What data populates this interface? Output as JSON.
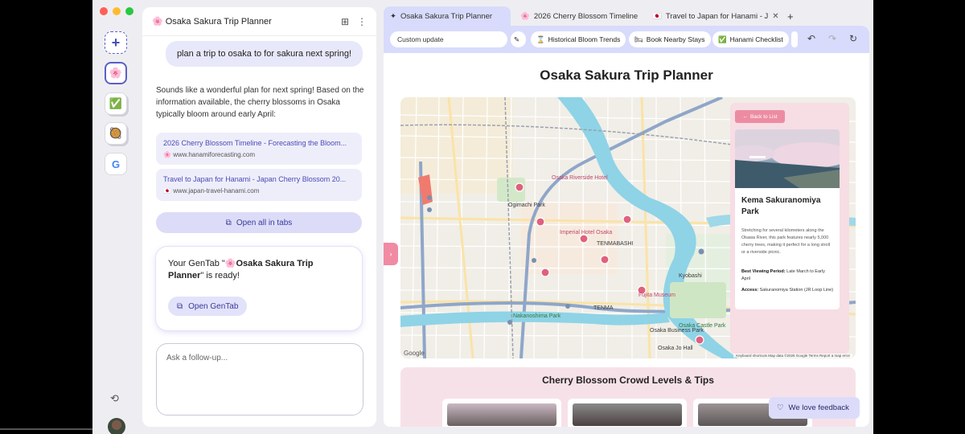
{
  "window": {
    "traffic_lights": {
      "close": "#ff5f57",
      "minimize": "#febc2e",
      "maximize": "#28c840"
    },
    "accent": "#5b5fc7"
  },
  "rail": {
    "items": [
      {
        "name": "new-tab-group",
        "icon": "plus-icon",
        "glyph": "+"
      },
      {
        "name": "sakura-group",
        "icon": "cherry-blossom-icon",
        "glyph": "🌸"
      },
      {
        "name": "checklist-group",
        "icon": "checkbox-icon",
        "glyph": "✅"
      },
      {
        "name": "food-group",
        "icon": "bowl-icon",
        "glyph": "🥘"
      },
      {
        "name": "google-group",
        "icon": "google-icon",
        "glyph": "G"
      }
    ]
  },
  "chat": {
    "title": "🌸 Osaka Sakura Trip Planner",
    "user_message": "plan a trip to osaka to for sakura next spring!",
    "answer": "Sounds like a wonderful plan for next spring! Based on the information available, the cherry blossoms in Osaka typically bloom around early April:",
    "sources": [
      {
        "title": "2026 Cherry Blossom Timeline - Forecasting the Bloom...",
        "url": "www.hanamiforecasting.com",
        "favicon": "🌸"
      },
      {
        "title": "Travel to Japan for Hanami - Japan Cherry Blossom 20...",
        "url": "www.japan-travel-hanami.com",
        "favicon": "🇯🇵"
      }
    ],
    "open_all_label": "Open all in tabs",
    "ready_prefix": "Your GenTab \"",
    "ready_name": "🌸Osaka Sakura Trip Planner",
    "ready_suffix": "\" is ready!",
    "open_gentab_label": "Open GenTab",
    "followup_placeholder": "Ask a follow-up..."
  },
  "browser": {
    "tabs": [
      {
        "label": "Osaka Sakura Trip Planner",
        "icon": "sparkle-icon",
        "glyph": "✦"
      },
      {
        "label": "2026 Cherry Blossom Timeline",
        "icon": "cherry-blossom-icon",
        "glyph": "🌸"
      },
      {
        "label": "Travel to Japan for Hanami - J",
        "icon": "japan-flag-icon",
        "glyph": "🇯🇵"
      }
    ],
    "new_tab_glyph": "+",
    "address": "Custom update",
    "chips": [
      {
        "label": "Historical Bloom Trends",
        "glyph": "⌛"
      },
      {
        "label": "Book Nearby Stays",
        "glyph": "🛏"
      },
      {
        "label": "Hanami Checklist",
        "glyph": "✅"
      }
    ],
    "page_title": "Osaka Sakura Trip Planner",
    "map": {
      "labels": [
        "Osaka Riverside Hotel",
        "Ogimachi Park",
        "Imperial Hotel Osaka",
        "TENMABASHI",
        "Osaka Castle Park",
        "Fujita Museum",
        "Osaka Business Park",
        "Nakanoshima Park",
        "Kyobashi",
        "TENMA",
        "Osaka Jo Hall"
      ],
      "attribution": "Keyboard shortcuts   Map data ©2026 Google   Terms   Report a map error",
      "google_mark": "Google"
    },
    "info": {
      "back_label": "Back to List",
      "name": "Kema Sakuranomiya Park",
      "description": "Stretching for several kilometers along the Okawa River, this park features nearly 5,000 cherry trees, making it perfect for a long stroll or a riverside picnic.",
      "best_label": "Best Viewing Period:",
      "best_value": "Late March to Early April",
      "access_label": "Access:",
      "access_value": "Sakuranomiya Station (JR Loop Line)"
    },
    "crowd_title": "Cherry Blossom Crowd Levels & Tips",
    "feedback_label": "We love feedback"
  }
}
